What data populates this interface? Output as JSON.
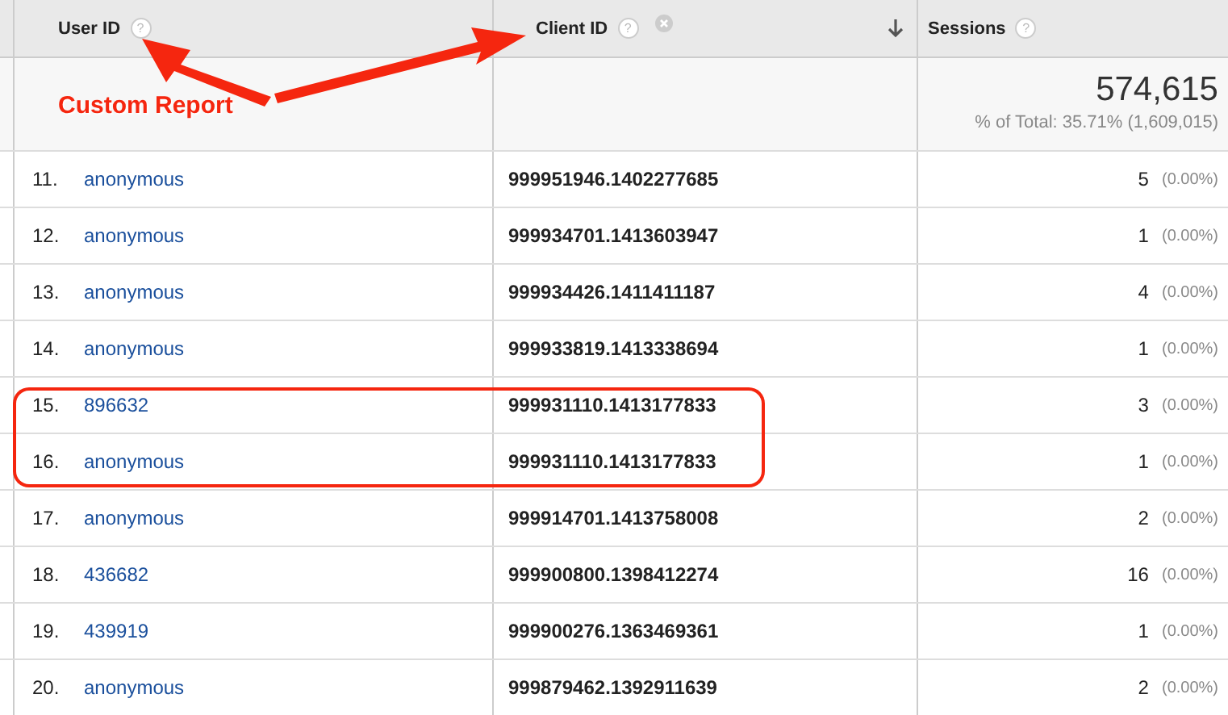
{
  "table": {
    "columns": [
      {
        "label": "User ID",
        "help": "?",
        "removable": false,
        "sorted": false
      },
      {
        "label": "Client ID",
        "help": "?",
        "removable": true,
        "sorted": true
      },
      {
        "label": "Sessions",
        "help": "?",
        "removable": false,
        "sorted": false
      }
    ],
    "totals": {
      "value": "574,615",
      "share": "% of Total: 35.71% (1,609,015)"
    },
    "rows": [
      {
        "index": "11.",
        "user_id": "anonymous",
        "client_id": "999951946.1402277685",
        "sessions": "5",
        "percent": "(0.00%)",
        "circled": false
      },
      {
        "index": "12.",
        "user_id": "anonymous",
        "client_id": "999934701.1413603947",
        "sessions": "1",
        "percent": "(0.00%)",
        "circled": false
      },
      {
        "index": "13.",
        "user_id": "anonymous",
        "client_id": "999934426.1411411187",
        "sessions": "4",
        "percent": "(0.00%)",
        "circled": false
      },
      {
        "index": "14.",
        "user_id": "anonymous",
        "client_id": "999933819.1413338694",
        "sessions": "1",
        "percent": "(0.00%)",
        "circled": false
      },
      {
        "index": "15.",
        "user_id": "896632",
        "client_id": "999931110.1413177833",
        "sessions": "3",
        "percent": "(0.00%)",
        "circled": true
      },
      {
        "index": "16.",
        "user_id": "anonymous",
        "client_id": "999931110.1413177833",
        "sessions": "1",
        "percent": "(0.00%)",
        "circled": true
      },
      {
        "index": "17.",
        "user_id": "anonymous",
        "client_id": "999914701.1413758008",
        "sessions": "2",
        "percent": "(0.00%)",
        "circled": false
      },
      {
        "index": "18.",
        "user_id": "436682",
        "client_id": "999900800.1398412274",
        "sessions": "16",
        "percent": "(0.00%)",
        "circled": false
      },
      {
        "index": "19.",
        "user_id": "439919",
        "client_id": "999900276.1363469361",
        "sessions": "1",
        "percent": "(0.00%)",
        "circled": false
      },
      {
        "index": "20.",
        "user_id": "anonymous",
        "client_id": "999879462.1392911639",
        "sessions": "2",
        "percent": "(0.00%)",
        "circled": false
      }
    ]
  },
  "annotation": {
    "text": "Custom Report"
  }
}
